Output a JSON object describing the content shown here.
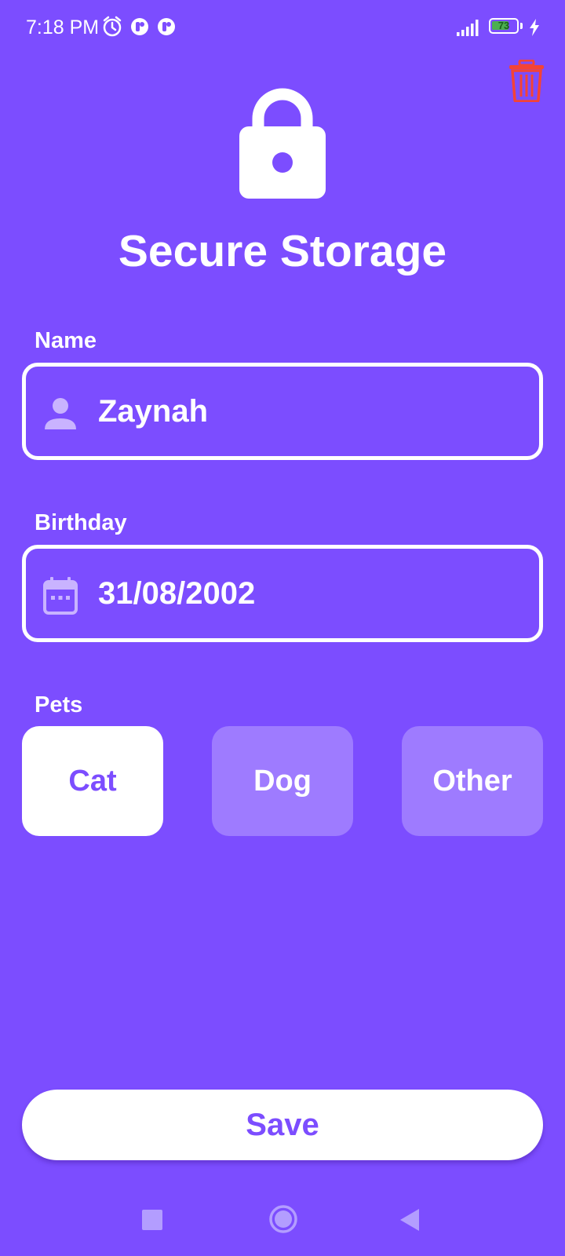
{
  "status_bar": {
    "time": "7:18 PM",
    "battery_level": 73,
    "battery_label": "73",
    "icons": [
      "alarm-icon",
      "app-notification-icon",
      "app-notification-icon",
      "signal-icon",
      "battery-icon",
      "charging-icon"
    ]
  },
  "header": {
    "title": "Secure Storage",
    "lock_icon": "lock-icon",
    "delete_icon": "trash-icon"
  },
  "form": {
    "name": {
      "label": "Name",
      "value": "Zaynah",
      "icon": "person-icon"
    },
    "birthday": {
      "label": "Birthday",
      "value": "31/08/2002",
      "icon": "calendar-icon"
    },
    "pets": {
      "label": "Pets",
      "options": [
        "Cat",
        "Dog",
        "Other"
      ],
      "selected": "Cat"
    }
  },
  "actions": {
    "save_label": "Save"
  },
  "nav_bar": {
    "buttons": [
      "recents-icon",
      "home-icon",
      "back-icon"
    ]
  },
  "colors": {
    "background": "#7c4dff",
    "accent_text": "#7c4dff",
    "unselected_chip": "#9e7bff",
    "delete": "#f44336",
    "battery": "#4caf50"
  }
}
